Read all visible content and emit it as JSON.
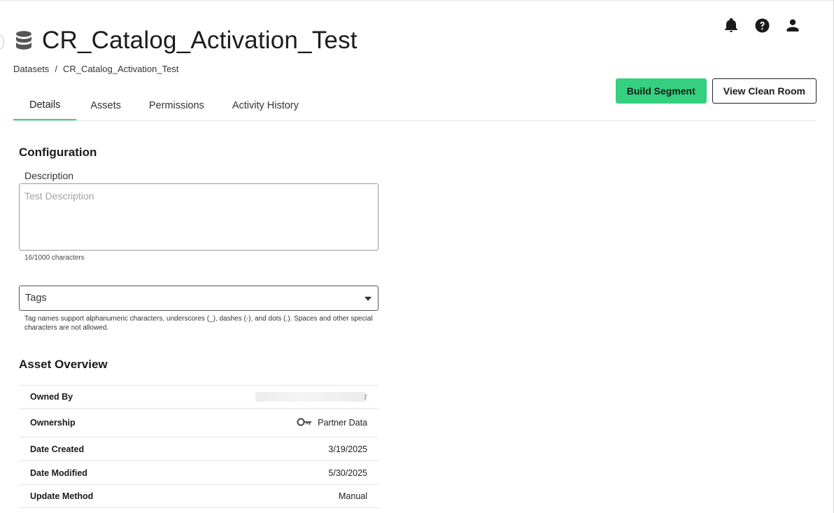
{
  "header": {
    "icons": [
      "bell-icon",
      "help-icon",
      "user-icon"
    ]
  },
  "title": {
    "icon": "database-icon",
    "text": "CR_Catalog_Activation_Test"
  },
  "breadcrumb": {
    "root": "Datasets",
    "separator": "/",
    "current": "CR_Catalog_Activation_Test"
  },
  "actions": {
    "build_segment": "Build Segment",
    "view_clean_room": "View Clean Room"
  },
  "tabs": [
    {
      "label": "Details",
      "active": true
    },
    {
      "label": "Assets",
      "active": false
    },
    {
      "label": "Permissions",
      "active": false
    },
    {
      "label": "Activity History",
      "active": false
    }
  ],
  "configuration": {
    "title": "Configuration",
    "description_label": "Description",
    "description_placeholder": "Test Description",
    "char_count": "16/1000 characters",
    "tags_label": "Tags",
    "tags_help": "Tag names support alphanumeric characters, underscores (_), dashes (-), and dots (.). Spaces and other special characters are not allowed."
  },
  "asset_overview": {
    "title": "Asset Overview",
    "rows": [
      {
        "key": "Owned By",
        "value": "r"
      },
      {
        "key": "Ownership",
        "value": "Partner Data",
        "icon": "key-icon"
      },
      {
        "key": "Date Created",
        "value": "3/19/2025"
      },
      {
        "key": "Date Modified",
        "value": "5/30/2025"
      },
      {
        "key": "Update Method",
        "value": "Manual"
      }
    ]
  },
  "colors": {
    "accent": "#35d07f",
    "text": "#1a1a1a",
    "border": "#e4e4e4"
  }
}
